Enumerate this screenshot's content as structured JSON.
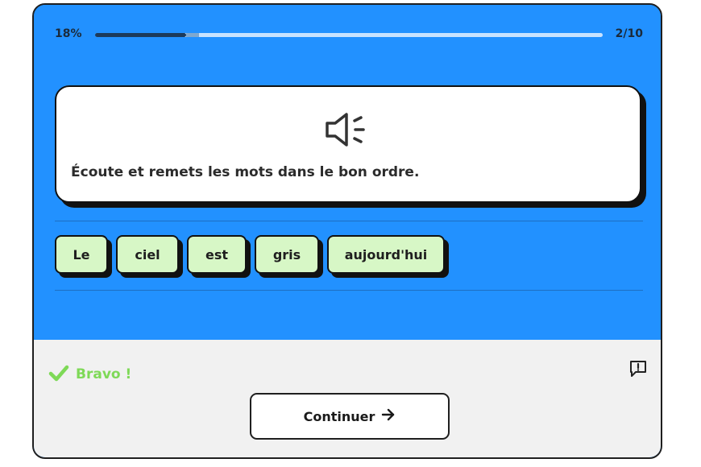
{
  "progress": {
    "percent_label": "18%",
    "fraction": 0.18,
    "count_label": "2/10"
  },
  "prompt": {
    "icon": "speaker-icon",
    "instruction": "Écoute et remets les mots dans le bon ordre."
  },
  "words": [
    {
      "label": "Le"
    },
    {
      "label": "ciel"
    },
    {
      "label": "est"
    },
    {
      "label": "gris"
    },
    {
      "label": "aujourd'hui"
    }
  ],
  "feedback": {
    "icon": "checkmark-icon",
    "text": "Bravo !",
    "color": "#7ed957"
  },
  "report": {
    "icon": "report-flag-icon"
  },
  "continue": {
    "label": "Continuer",
    "icon": "arrow-right-icon"
  },
  "colors": {
    "primary_blue": "#2291ff",
    "word_tile": "#d7f7c6",
    "footer_bg": "#f1f1f1"
  }
}
